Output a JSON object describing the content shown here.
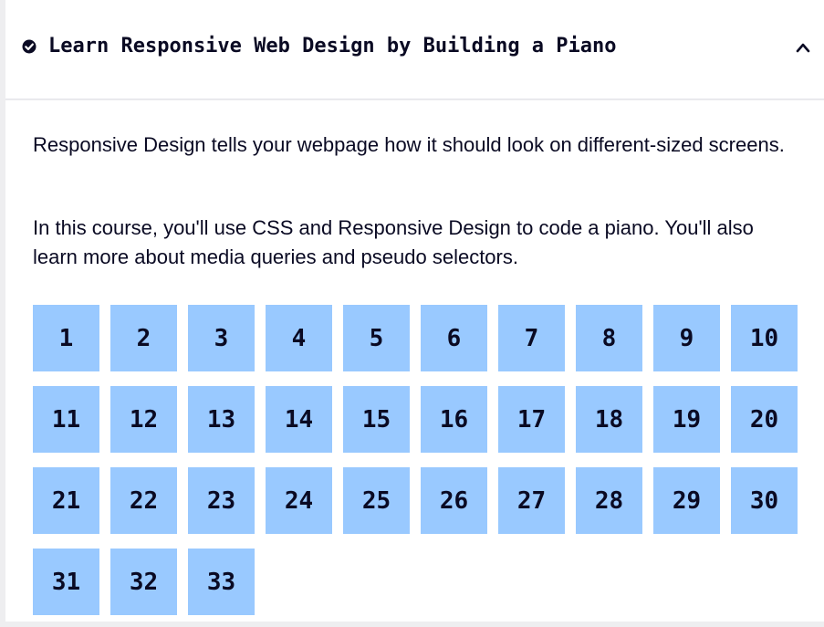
{
  "block": {
    "title": "Learn Responsive Web Design by Building a Piano",
    "status_icon": "check-circle-icon",
    "toggle_icon": "caret-up-icon",
    "description": [
      "Responsive Design tells your webpage how it should look on different-sized screens.",
      "In this course, you'll use CSS and Responsive Design to code a piano. You'll also learn more about media queries and pseudo selectors."
    ],
    "steps": [
      "1",
      "2",
      "3",
      "4",
      "5",
      "6",
      "7",
      "8",
      "9",
      "10",
      "11",
      "12",
      "13",
      "14",
      "15",
      "16",
      "17",
      "18",
      "19",
      "20",
      "21",
      "22",
      "23",
      "24",
      "25",
      "26",
      "27",
      "28",
      "29",
      "30",
      "31",
      "32",
      "33"
    ]
  },
  "colors": {
    "text": "#0a0a23",
    "step_bg": "#99c9ff",
    "page_bg": "#eeeef0"
  }
}
